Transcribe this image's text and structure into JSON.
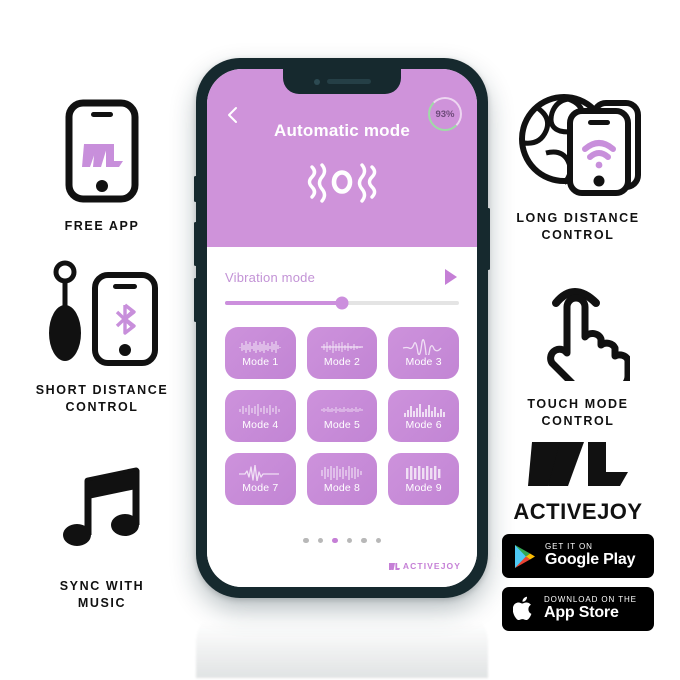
{
  "background_color": "#ffffff",
  "accent_purple": "#c57fd6",
  "header_purple": "#cf93da",
  "frame_color": "#16292e",
  "features_left": [
    {
      "id": "free-app",
      "icon": "phone-with-logo-icon",
      "caption": "FREE APP"
    },
    {
      "id": "short-distance",
      "icon": "toy-and-phone-bluetooth-icon",
      "caption": "SHORT DISTANCE\nCONTROL"
    },
    {
      "id": "sync-music",
      "icon": "music-note-icon",
      "caption": "SYNC WITH\nMUSIC"
    }
  ],
  "features_right": [
    {
      "id": "long-distance",
      "icon": "globe-phones-wifi-icon",
      "caption": "LONG DISTANCE\nCONTROL"
    },
    {
      "id": "touch-mode",
      "icon": "hand-tap-icon",
      "caption": "TOUCH MODE\nCONTROL"
    }
  ],
  "phone": {
    "header": {
      "back_icon": "chevron-left-icon",
      "title": "Automatic mode",
      "battery_percent": "93%",
      "center_icon": "vibration-waves-icon"
    },
    "slider": {
      "label": "Vibration mode",
      "play_icon": "play-icon",
      "value_percent": 50
    },
    "modes": [
      {
        "label": "Mode 1",
        "wave": "dense-spiky"
      },
      {
        "label": "Mode 2",
        "wave": "flat-line-burst"
      },
      {
        "label": "Mode 3",
        "wave": "smooth-swell"
      },
      {
        "label": "Mode 4",
        "wave": "medium-noise"
      },
      {
        "label": "Mode 5",
        "wave": "fine-grain"
      },
      {
        "label": "Mode 6",
        "wave": "equalizer-bars"
      },
      {
        "label": "Mode 7",
        "wave": "single-peak"
      },
      {
        "label": "Mode 8",
        "wave": "wide-envelope"
      },
      {
        "label": "Mode 9",
        "wave": "thick-bars"
      }
    ],
    "pagination": {
      "count": 6,
      "active_index": 2
    },
    "screen_brand": "ACTIVEJOY"
  },
  "brand": {
    "logo_icon": "activejoy-logo-icon",
    "name": "ACTIVEJOY",
    "stores": [
      {
        "id": "google-play",
        "icon": "google-play-icon",
        "small": "GET IT ON",
        "big": "Google Play"
      },
      {
        "id": "app-store",
        "icon": "apple-icon",
        "small": "Download on the",
        "big": "App Store"
      }
    ]
  }
}
